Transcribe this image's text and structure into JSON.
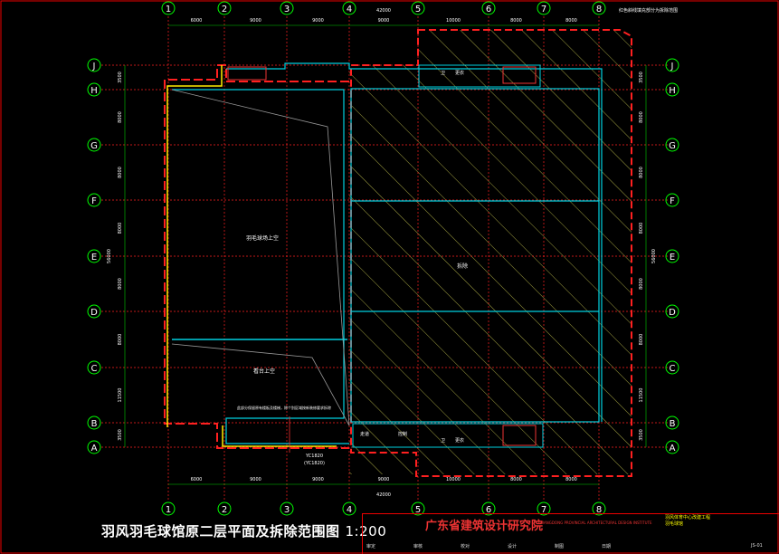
{
  "drawing": {
    "title": "羽风羽毛球馆原二层平面及拆除范围图",
    "scale": "1:200"
  },
  "grid": {
    "columns": [
      "1",
      "2",
      "3",
      "4",
      "5",
      "6",
      "7",
      "8"
    ],
    "rows": [
      "J",
      "H",
      "G",
      "F",
      "E",
      "D",
      "C",
      "B",
      "A"
    ],
    "col_spacings": [
      "6000",
      "9000",
      "9000",
      "9000",
      "10000",
      "8000",
      "8000"
    ],
    "row_spacings": [
      "3500",
      "8000",
      "8000",
      "8000",
      "8000",
      "8000",
      "11500",
      "3500"
    ],
    "total_width": "42000",
    "total_height": "56000"
  },
  "rooms": {
    "upper_area": "羽毛球场上空",
    "lower_area": "看台上空",
    "demolish_area": "拆除",
    "small_rooms_top": [
      "卫",
      "更衣"
    ],
    "small_rooms_bottom": [
      "走道",
      "控制",
      "卫",
      "更衣"
    ]
  },
  "annotations": {
    "legend_note": "红色斜线填充部分为拆除范围",
    "keep_note": "此部分保留原有楼板及楼梯，除个别区域按新装修要求拆除",
    "door_label_1": "YC1820",
    "door_label_2": "(YC1820)"
  },
  "title_block": {
    "institute": "广东省建筑设计研究院",
    "institute_en": "GUANGDONG PROVINCIAL ARCHITECTURAL DESIGN INSTITUTE",
    "project": "羽风体育中心改建工程",
    "sub_project": "羽毛球馆",
    "drawing_no": "JS-01",
    "labels": [
      "审定",
      "审核",
      "校对",
      "设计",
      "制图",
      "日期"
    ]
  },
  "colors": {
    "grid_line": "#ff2020",
    "bubble": "#00ff00",
    "wall": "#00d0e0",
    "hatch": "#d0d040",
    "demolish_boundary": "#ff2020",
    "text": "#ffffff"
  }
}
